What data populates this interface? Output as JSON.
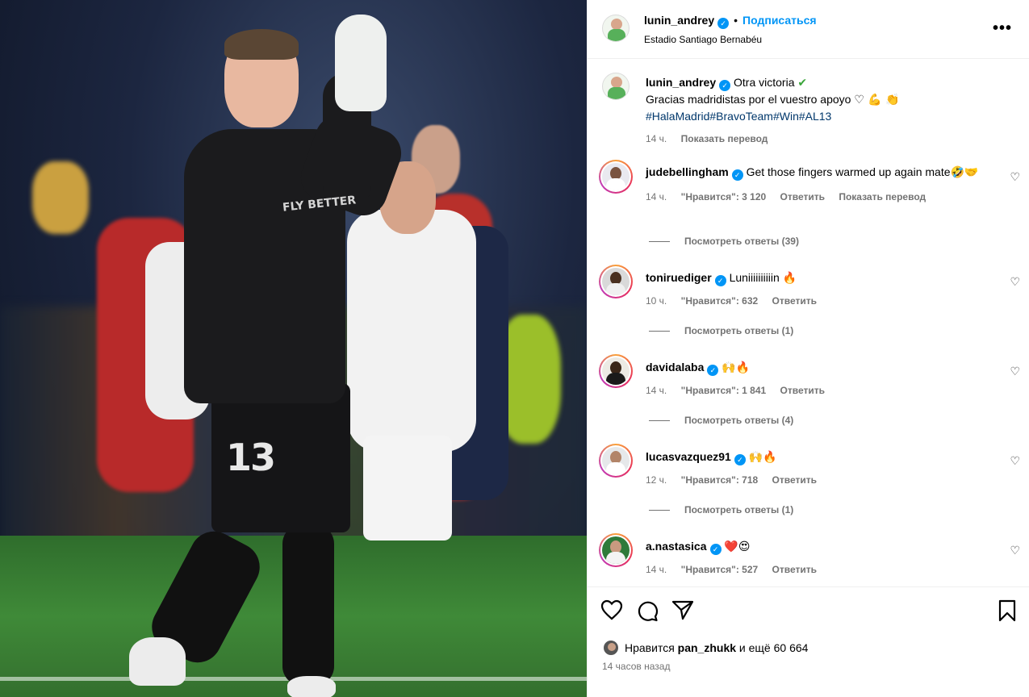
{
  "post": {
    "author": "lunin_andrey",
    "follow_label": "Подписаться",
    "separator": "•",
    "location": "Estadio Santiago Bernabéu",
    "more_label": "•••",
    "caption_title": "Otra victoria",
    "caption_check": "✔",
    "caption_line2": "Gracias madridistas por el vuestro apoyo",
    "caption_emojis": "♡ 💪 👏",
    "hashtags": "#HalaMadrid#BravoTeam#Win#AL13",
    "time": "14 ч.",
    "translate_label": "Показать перевод",
    "photo_number": "13",
    "photo_crest_text": "FLY BETTER"
  },
  "comments": [
    {
      "user": "judebellingham",
      "text": "Get those fingers warmed up again mate",
      "emoji": "🤣🤝",
      "time": "14 ч.",
      "likes": "\"Нравится\": 3 120",
      "reply": "Ответить",
      "translate": "Показать перевод",
      "replies": "Посмотреть ответы (39)"
    },
    {
      "user": "toniruediger",
      "text": "Luniiiiiiiiiin",
      "emoji": "🔥",
      "time": "10 ч.",
      "likes": "\"Нравится\": 632",
      "reply": "Ответить",
      "replies": "Посмотреть ответы (1)"
    },
    {
      "user": "davidalaba",
      "text": "",
      "emoji": "🙌🔥",
      "time": "14 ч.",
      "likes": "\"Нравится\": 1 841",
      "reply": "Ответить",
      "replies": "Посмотреть ответы (4)"
    },
    {
      "user": "lucasvazquez91",
      "text": "",
      "emoji": "🙌🔥",
      "time": "12 ч.",
      "likes": "\"Нравится\": 718",
      "reply": "Ответить",
      "replies": "Посмотреть ответы (1)"
    },
    {
      "user": "a.nastasica",
      "text": "",
      "emoji": "❤️😍",
      "time": "14 ч.",
      "likes": "\"Нравится\": 527",
      "reply": "Ответить"
    }
  ],
  "footer": {
    "likes_prefix": "Нравится",
    "likes_user": "pan_zhukk",
    "likes_suffix": "и ещё 60 664",
    "time_ago": "14 часов назад"
  },
  "icons": {
    "like": "heart-icon",
    "comment": "comment-icon",
    "share": "share-icon",
    "save": "bookmark-icon",
    "more": "more-icon",
    "verified": "verified-icon"
  }
}
